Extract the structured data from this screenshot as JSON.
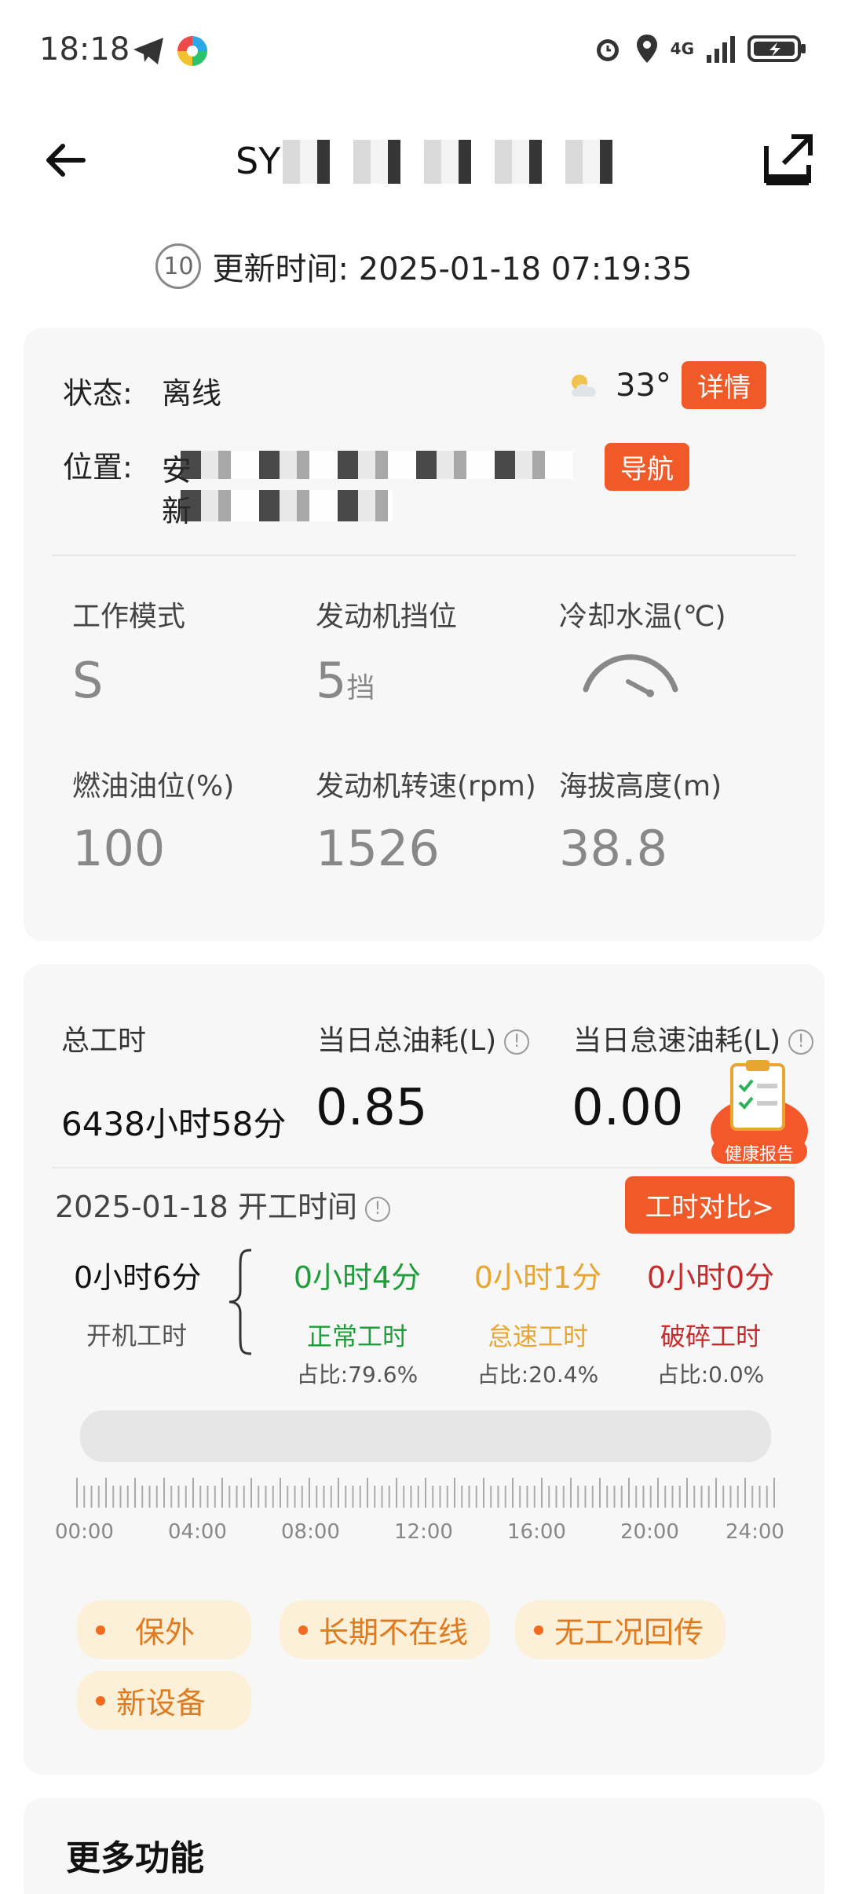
{
  "status_bar": {
    "time": "18:18",
    "network": "4G",
    "icons": [
      "telegram-icon",
      "pinwheel-app-icon",
      "alarm-icon",
      "location-icon",
      "signal-icon",
      "battery-charging-icon"
    ]
  },
  "header": {
    "title": "SY",
    "back_icon": "back-arrow-icon",
    "share_icon": "share-icon"
  },
  "update": {
    "countdown": "10",
    "text": "更新时间: 2025-01-18 07:19:35"
  },
  "status_card": {
    "status_label": "状态:",
    "status_value": "离线",
    "weather_temp": "33°",
    "details_button": "详情",
    "location_label": "位置:",
    "location_line1": "安",
    "location_line2": "新",
    "nav_button": "导航",
    "metrics": [
      {
        "label": "工作模式",
        "value": "S",
        "unit": ""
      },
      {
        "label": "发动机挡位",
        "value": "5",
        "unit": "挡"
      },
      {
        "label": "冷却水温(℃)",
        "value": "",
        "unit": ""
      },
      {
        "label": "燃油油位(%)",
        "value": "100",
        "unit": ""
      },
      {
        "label": "发动机转速(rpm)",
        "value": "1526",
        "unit": ""
      },
      {
        "label": "海拔高度(m)",
        "value": "38.8",
        "unit": ""
      }
    ]
  },
  "work_card": {
    "total_hours_label": "总工时",
    "total_hours_value": "6438小时58分",
    "daily_fuel_label": "当日总油耗(L)",
    "daily_fuel_value": "0.85",
    "idle_fuel_label": "当日怠速油耗(L)",
    "idle_fuel_value": "0.00",
    "health_report_label": "健康报告",
    "date": "2025-01-18",
    "work_time_label": "开工时间",
    "compare_button": "工时对比>",
    "power_on_value": "0小时6分",
    "power_on_label": "开机工时",
    "categories": [
      {
        "value": "0小时4分",
        "name": "正常工时",
        "ratio": "占比:79.6%"
      },
      {
        "value": "0小时1分",
        "name": "怠速工时",
        "ratio": "占比:20.4%"
      },
      {
        "value": "0小时0分",
        "name": "破碎工时",
        "ratio": "占比:0.0%"
      }
    ],
    "timeline_labels": [
      "00:00",
      "04:00",
      "08:00",
      "12:00",
      "16:00",
      "20:00",
      "24:00"
    ],
    "tags": [
      "保外",
      "长期不在线",
      "无工况回传",
      "新设备"
    ]
  },
  "more": {
    "title": "更多功能"
  },
  "colors": {
    "accent": "#f05a28",
    "normal": "#1f9d3a",
    "idle": "#e8a631",
    "break": "#c52b2b",
    "tag_bg": "#fdf0d8"
  }
}
